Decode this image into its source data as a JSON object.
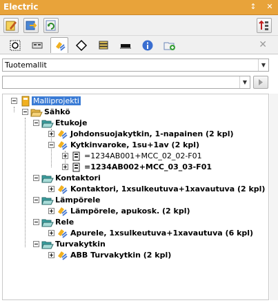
{
  "window": {
    "title": "Electric",
    "pin_icon": "pin-icon",
    "close_icon": "close-icon"
  },
  "toolbar": {
    "buttons": [
      "edit-icon",
      "export-icon",
      "refresh-icon"
    ],
    "right_button": "sort-icon"
  },
  "tabs": [
    "symbol-tab",
    "device-tab",
    "product-models-tab",
    "diamond-tab",
    "stack-tab",
    "terminal-tab",
    "info-tab",
    "new-folder-tab"
  ],
  "combo": {
    "value": "Tuotemallit"
  },
  "filter": {
    "value": ""
  },
  "tree": {
    "root": "Malliprojekti",
    "sahko": "Sähkö",
    "etukoje": "Etukoje",
    "johdonsuoja": "Johdonsuojakytkin, 1-napainen (2 kpl)",
    "kytkinvaroke": "Kytkinvaroke, 1su+1av (2 kpl)",
    "kv_item1": "=1234AB001+MCC_02_02-F01",
    "kv_item2": "=1234AB002+MCC_03_03-F01",
    "kontaktori": "Kontaktori",
    "kontaktori_item": "Kontaktori, 1xsulkeutuva+1xavautuva (2 kpl)",
    "lamporele": "Lämpörele",
    "lamporele_item": "Lämpörele, apukosk. (2 kpl)",
    "rele": "Rele",
    "rele_item": "Apurele, 1xsulkeutuva+1xavautuva (6 kpl)",
    "turvakytkin": "Turvakytkin",
    "turvakytkin_item": "ABB Turvakytkin (2 kpl)"
  },
  "colors": {
    "title_bg": "#e8a33a",
    "selection": "#3a7bd5",
    "folder": "#e8b84a"
  }
}
